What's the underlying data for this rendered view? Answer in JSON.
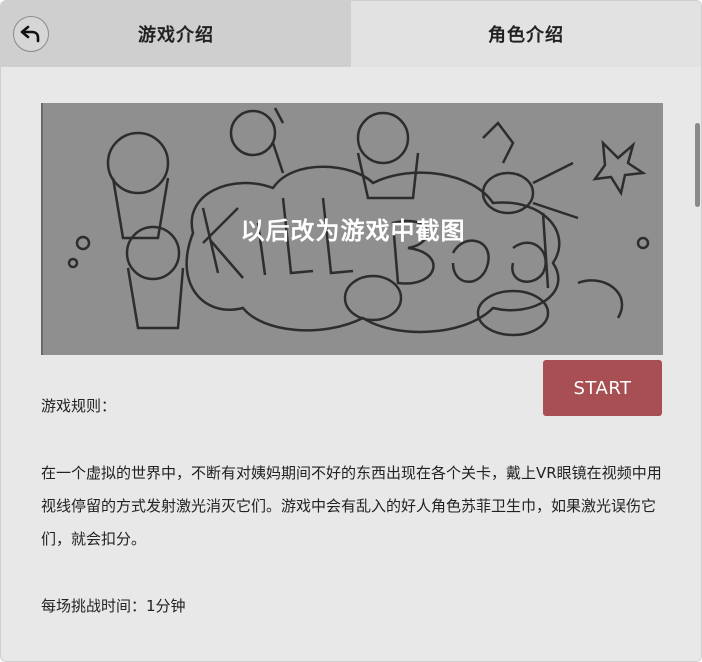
{
  "tabs": [
    {
      "label": "游戏介绍",
      "active": true
    },
    {
      "label": "角色介绍",
      "active": false
    }
  ],
  "back_icon": "back-arrow-icon",
  "banner": {
    "caption": "以后改为游戏中截图",
    "art_title": "Kill Bad"
  },
  "start_button": {
    "label": "START"
  },
  "rules": {
    "title": "游戏规则：",
    "description": "在一个虚拟的世界中，不断有对姨妈期间不好的东西出现在各个关卡，戴上VR眼镜在视频中用视线停留的方式发射激光消灭它们。游戏中会有乱入的好人角色苏菲卫生巾，如果激光误伤它们，就会扣分。",
    "time": "每场挑战时间：1分钟"
  },
  "colors": {
    "start_button": "#a84f53",
    "tab_active": "#cfcfcf",
    "tab_inactive": "#e2e2e2",
    "background": "#e8e8e8",
    "banner_overlay": "#8f8f8f"
  }
}
